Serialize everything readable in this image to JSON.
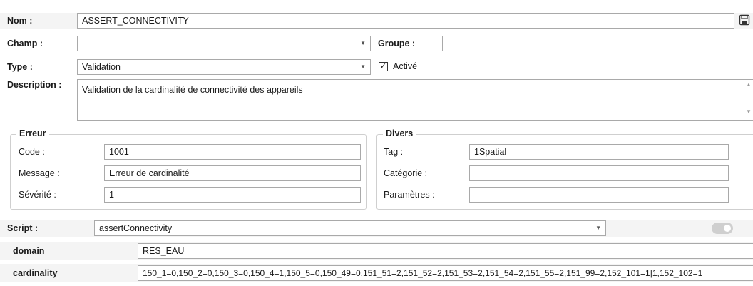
{
  "form": {
    "nom_label": "Nom :",
    "nom_value": "ASSERT_CONNECTIVITY",
    "champ_label": "Champ :",
    "champ_value": "",
    "groupe_label": "Groupe :",
    "groupe_value": "",
    "type_label": "Type :",
    "type_value": "Validation",
    "active_label": "Activé",
    "active_checked": true,
    "description_label": "Description :",
    "description_value": "Validation de la cardinalité de connectivité des appareils"
  },
  "erreur": {
    "title": "Erreur",
    "code_label": "Code :",
    "code_value": "1001",
    "message_label": "Message :",
    "message_value": "Erreur de cardinalité",
    "severite_label": "Sévérité :",
    "severite_value": "1"
  },
  "divers": {
    "title": "Divers",
    "tag_label": "Tag :",
    "tag_value": "1Spatial",
    "categorie_label": "Catégorie :",
    "categorie_value": "",
    "parametres_label": "Paramètres :",
    "parametres_value": ""
  },
  "script": {
    "label": "Script :",
    "value": "assertConnectivity",
    "params": [
      {
        "name": "domain",
        "value": "RES_EAU"
      },
      {
        "name": "cardinality",
        "value": "150_1=0,150_2=0,150_3=0,150_4=1,150_5=0,150_49=0,151_51=2,151_52=2,151_53=2,151_54=2,151_55=2,151_99=2,152_101=1|1,152_102=1"
      }
    ]
  },
  "icons": {
    "save": "save-icon",
    "dropdown": "chevron-down-icon",
    "toggle": "toggle-switch"
  }
}
